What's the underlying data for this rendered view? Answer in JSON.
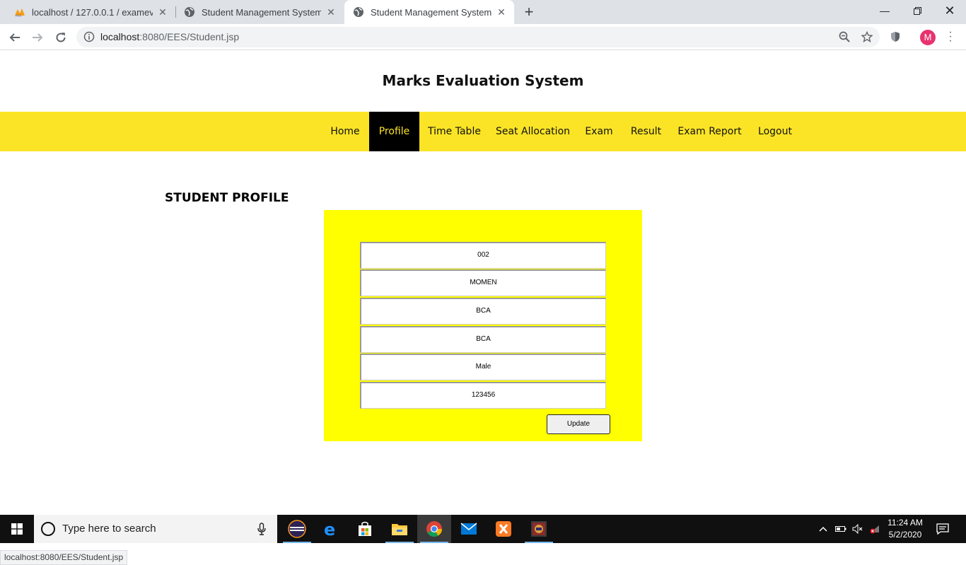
{
  "browser": {
    "tabs": [
      {
        "title": "localhost / 127.0.0.1 / examevalu",
        "active": false
      },
      {
        "title": "Student Management System",
        "active": false
      },
      {
        "title": "Student Management System",
        "active": true
      }
    ],
    "new_tab": "+",
    "url_host": "localhost",
    "url_path": ":8080/EES/Student.jsp",
    "profile_initial": "M",
    "status_url": "localhost:8080/EES/Student.jsp"
  },
  "site": {
    "title": "Marks Evaluation System",
    "nav": [
      {
        "label": "Home",
        "active": false
      },
      {
        "label": "Profile",
        "active": true
      },
      {
        "label": "Time Table",
        "active": false
      },
      {
        "label": "Seat Allocation",
        "active": false
      },
      {
        "label": "Exam",
        "active": false
      },
      {
        "label": "Result",
        "active": false
      },
      {
        "label": "Exam Report",
        "active": false
      },
      {
        "label": "Logout",
        "active": false
      }
    ]
  },
  "profile": {
    "heading": "STUDENT PROFILE",
    "fields": [
      "002",
      "MOMEN",
      "BCA",
      "BCA",
      "Male",
      "123456"
    ],
    "update_label": "Update"
  },
  "taskbar": {
    "search_placeholder": "Type here to search",
    "time": "11:24 AM",
    "date": "5/2/2020"
  },
  "colors": {
    "nav_bg": "#fbe426",
    "form_bg": "#ffff00",
    "active_nav_bg": "#000000"
  }
}
